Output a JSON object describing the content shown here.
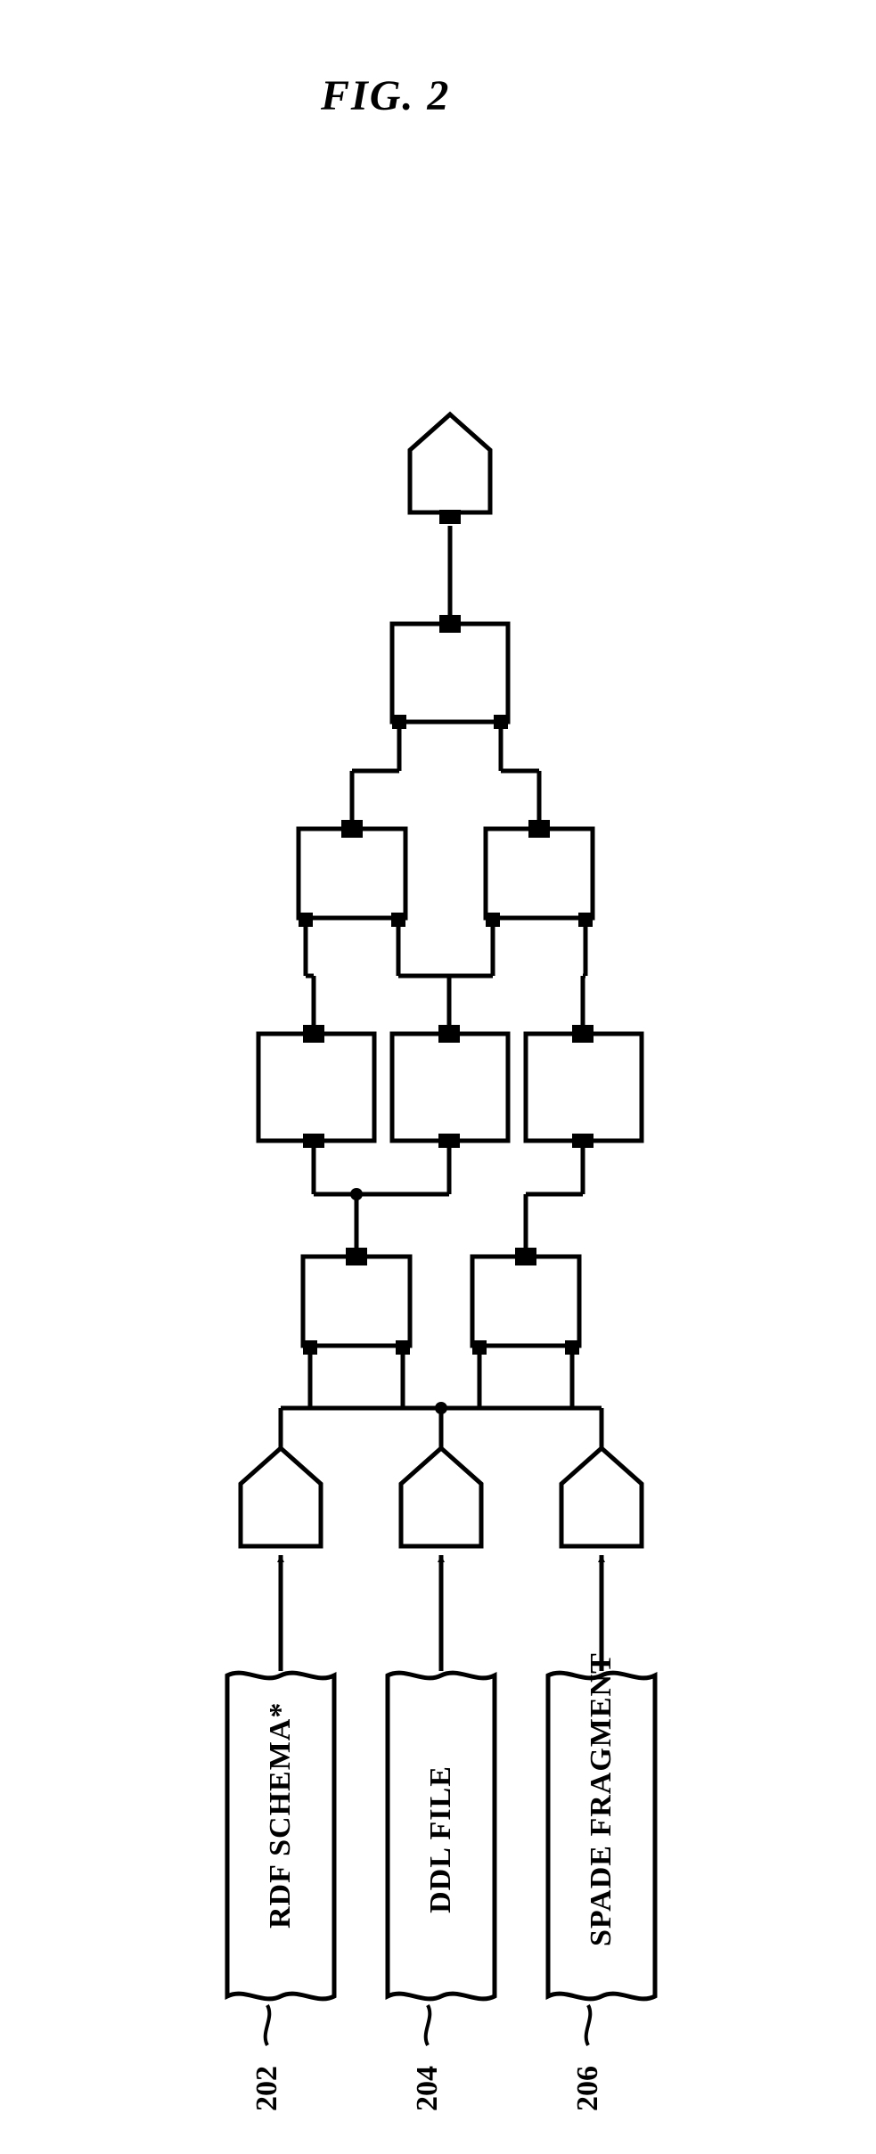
{
  "figure": {
    "title": "FIG. 2"
  },
  "inputs": {
    "item1": {
      "label": "RDF SCHEMA*",
      "ref": "202"
    },
    "item2": {
      "label": "DDL FILE",
      "ref": "204"
    },
    "item3": {
      "label": "SPADE FRAGMENT",
      "ref": "206"
    }
  }
}
